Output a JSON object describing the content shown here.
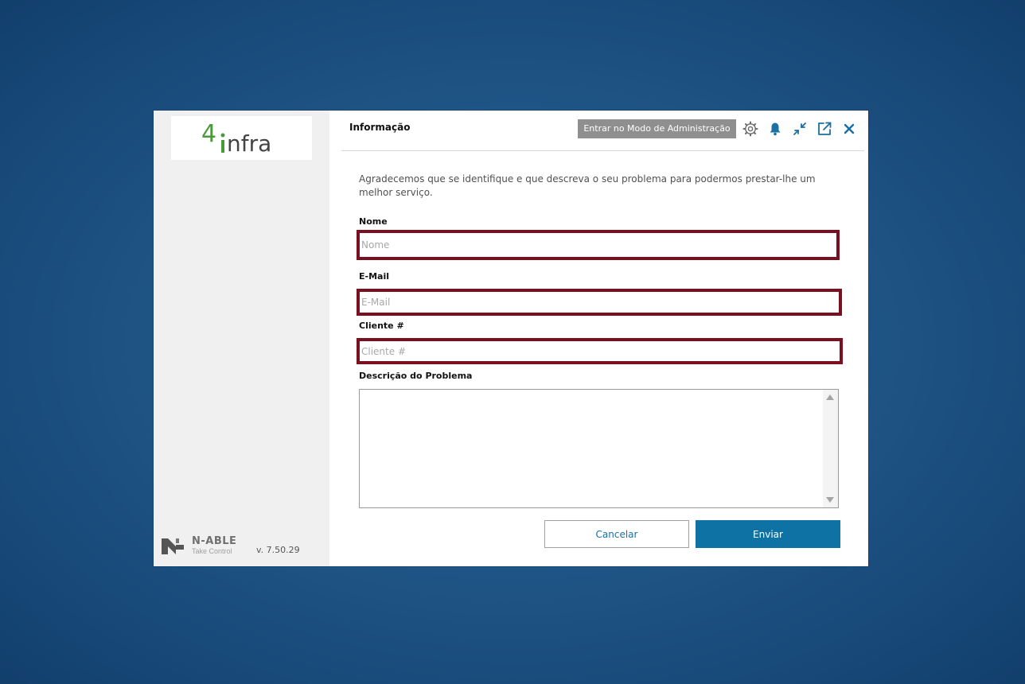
{
  "brand": {
    "logo_text_number": "4",
    "logo_text_word": "infra",
    "logo_number_color": "#4a9a3a",
    "logo_word_color": "#444444",
    "vendor_name": "N-ABLE",
    "vendor_product": "Take Control",
    "version": "v. 7.50.29"
  },
  "header": {
    "title": "Informação",
    "admin_button_label": "Entrar no Modo de Administração",
    "icons": [
      "gear-icon",
      "bell-icon",
      "collapse-icon",
      "external-link-icon",
      "close-icon"
    ],
    "icon_color": "#1a6fa3"
  },
  "form": {
    "intro_text": "Agradecemos que se identifique e que descreva o seu problema para podermos prestar-lhe um melhor serviço.",
    "name_label": "Nome",
    "name_placeholder": "Nome",
    "name_value": "",
    "email_label": "E-Mail",
    "email_placeholder": "E-Mail",
    "email_value": "",
    "client_label": "Cliente #",
    "client_placeholder": "Cliente #",
    "client_value": "",
    "description_label": "Descrição do Problema",
    "description_value": "",
    "highlight_color": "#7a0f20"
  },
  "actions": {
    "cancel_label": "Cancelar",
    "send_label": "Enviar",
    "send_color": "#0e72a4"
  }
}
